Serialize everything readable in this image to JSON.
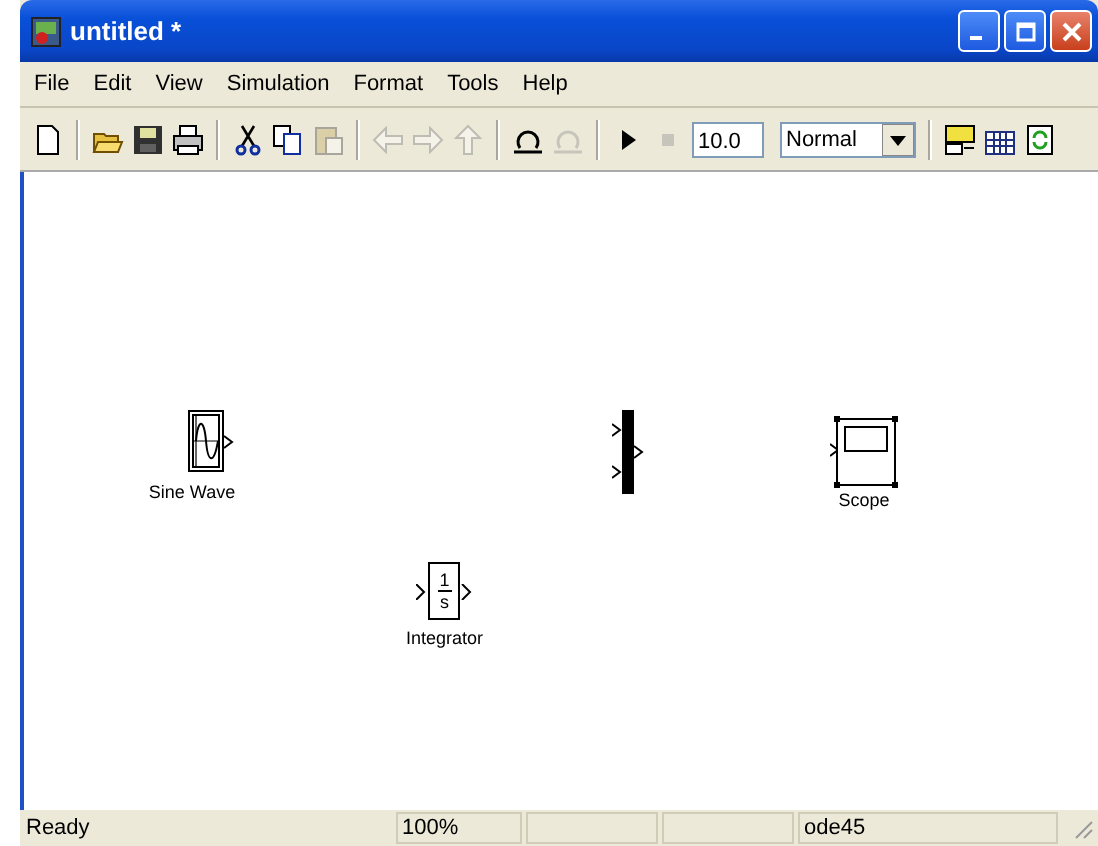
{
  "window": {
    "title": "untitled *"
  },
  "menu": [
    "File",
    "Edit",
    "View",
    "Simulation",
    "Format",
    "Tools",
    "Help"
  ],
  "toolbar": [
    {
      "kind": "new",
      "disabled": false
    },
    {
      "kind": "sep"
    },
    {
      "kind": "open",
      "disabled": false
    },
    {
      "kind": "save",
      "disabled": false
    },
    {
      "kind": "print",
      "disabled": false
    },
    {
      "kind": "sep"
    },
    {
      "kind": "cut",
      "disabled": false
    },
    {
      "kind": "copy",
      "disabled": false
    },
    {
      "kind": "paste",
      "disabled": true
    },
    {
      "kind": "sep"
    },
    {
      "kind": "back",
      "disabled": true
    },
    {
      "kind": "forward",
      "disabled": true
    },
    {
      "kind": "up",
      "disabled": true
    },
    {
      "kind": "sep"
    },
    {
      "kind": "undo",
      "disabled": false
    },
    {
      "kind": "redo",
      "disabled": true
    },
    {
      "kind": "sep"
    },
    {
      "kind": "start",
      "disabled": false
    },
    {
      "kind": "stop",
      "disabled": true
    }
  ],
  "stop_time": {
    "value": "10.0"
  },
  "sim_mode": {
    "value": "Normal"
  },
  "toolbar_right": [
    {
      "kind": "library"
    },
    {
      "kind": "grid"
    },
    {
      "kind": "refresh"
    }
  ],
  "blocks": [
    {
      "kind": "sine",
      "label": "Sine Wave",
      "selected": false
    },
    {
      "kind": "mux",
      "selected": false
    },
    {
      "kind": "scope",
      "label": "Scope",
      "selected": true
    },
    {
      "kind": "integrator",
      "numerator": "1",
      "denominator": "s",
      "label": "Integrator",
      "selected": false
    }
  ],
  "status_bar": {
    "message": "Ready",
    "zoom": "100%",
    "solver": "ode45"
  }
}
